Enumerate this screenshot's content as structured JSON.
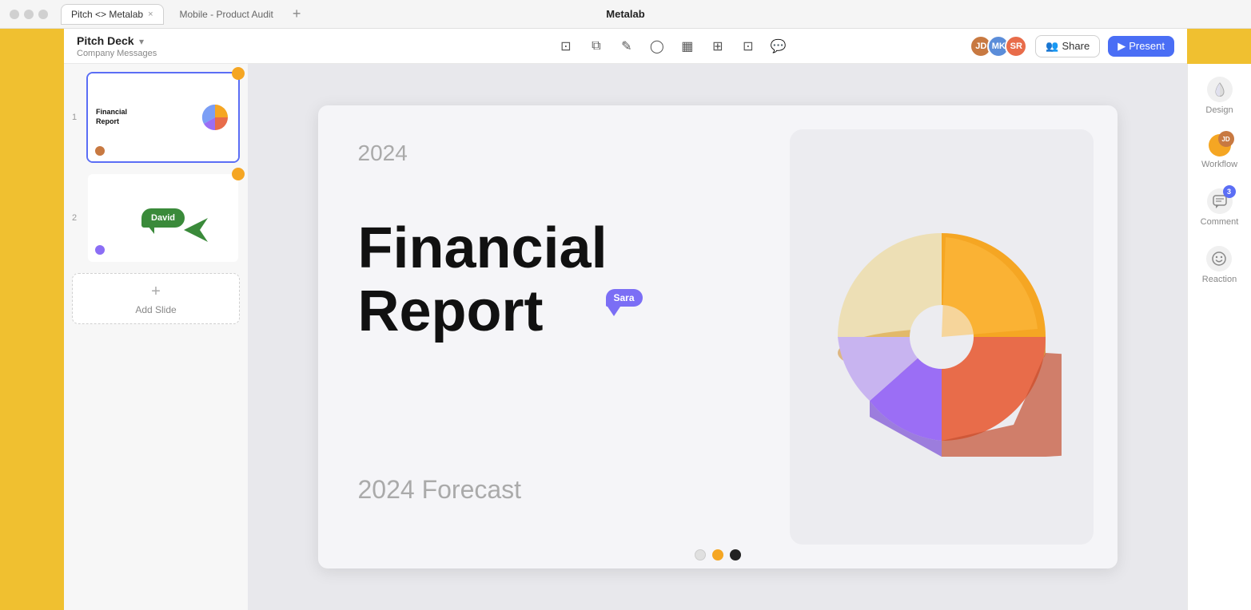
{
  "titlebar": {
    "app_name": "Metalab",
    "tab_active": "Pitch <> Metalab",
    "tab_inactive": "Mobile - Product Audit",
    "tab_add": "+"
  },
  "toolbar": {
    "title": "Pitch Deck",
    "subtitle": "Company Messages",
    "share_label": "Share",
    "present_label": "Present",
    "tools": [
      "frame",
      "copy",
      "edit",
      "circle",
      "chart",
      "table",
      "crop",
      "comment"
    ]
  },
  "slides": [
    {
      "num": "1",
      "active": true,
      "title": "Financial Report"
    },
    {
      "num": "2",
      "active": false,
      "title": "David"
    }
  ],
  "add_slide_label": "Add Slide",
  "canvas": {
    "year": "2024",
    "title_line1": "Financial",
    "title_line2": "Report",
    "subtitle": "2024 Forecast"
  },
  "cursors": {
    "sara_label": "Sara"
  },
  "dots": {
    "colors": [
      "#e0e0e0",
      "#f5a623",
      "#222222"
    ]
  },
  "right_panel": {
    "design_label": "Design",
    "workflow_label": "Workflow",
    "comment_label": "Comment",
    "reaction_label": "Reaction",
    "comment_badge": "3"
  }
}
